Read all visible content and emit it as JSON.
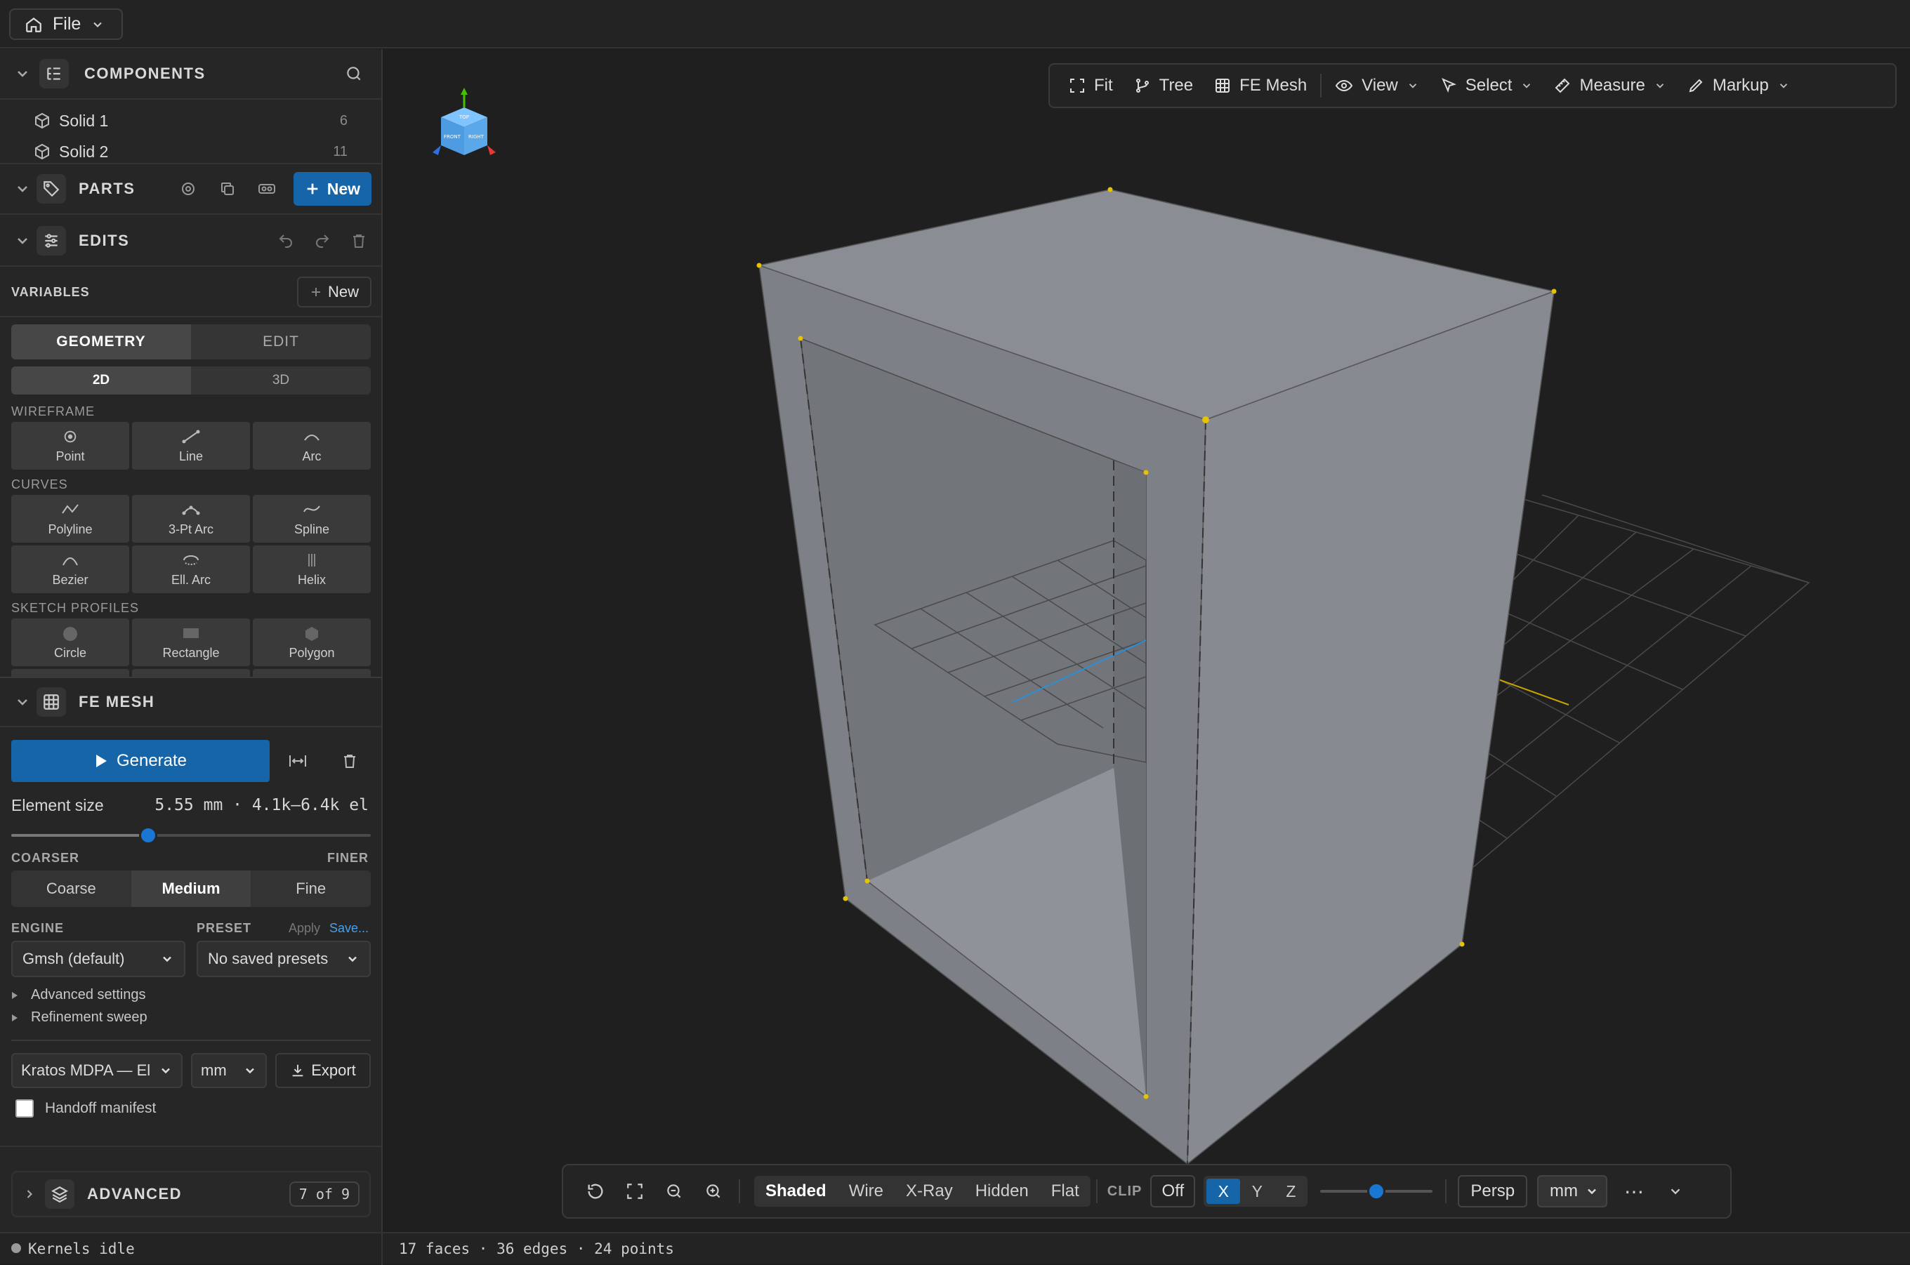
{
  "topbar": {
    "file_label": "File"
  },
  "components": {
    "title": "COMPONENTS",
    "items": [
      {
        "label": "Solid 1",
        "count": "6"
      },
      {
        "label": "Solid 2",
        "count": "11"
      }
    ]
  },
  "parts": {
    "title": "PARTS",
    "new_label": "New"
  },
  "edits": {
    "title": "EDITS"
  },
  "variables": {
    "title": "VARIABLES",
    "new_label": "New"
  },
  "geometry": {
    "tabs": [
      "GEOMETRY",
      "EDIT"
    ],
    "dims": [
      "2D",
      "3D"
    ],
    "wireframe_label": "WIREFRAME",
    "wireframe": [
      "Point",
      "Line",
      "Arc"
    ],
    "curves_label": "CURVES",
    "curves": [
      "Polyline",
      "3-Pt Arc",
      "Spline",
      "Bezier",
      "Ell. Arc",
      "Helix"
    ],
    "profiles_label": "SKETCH PROFILES",
    "profiles": [
      "Circle",
      "Rectangle",
      "Polygon"
    ]
  },
  "femesh": {
    "title": "FE MESH",
    "generate_label": "Generate",
    "element_size_label": "Element size",
    "element_size_value": "5.55 mm · 4.1k–6.4k el",
    "slider_fraction": 0.38,
    "coarser_label": "COARSER",
    "finer_label": "FINER",
    "density_options": [
      "Coarse",
      "Medium",
      "Fine"
    ],
    "density_selected": "Medium",
    "engine_label": "ENGINE",
    "engine_value": "Gmsh (default)",
    "preset_label": "PRESET",
    "preset_apply": "Apply",
    "preset_save": "Save...",
    "preset_value": "No saved presets",
    "advanced_settings": "Advanced settings",
    "refinement_sweep": "Refinement sweep",
    "export_format": "Kratos MDPA — El",
    "export_unit": "mm",
    "export_label": "Export",
    "handoff_label": "Handoff manifest"
  },
  "advanced": {
    "title": "ADVANCED",
    "badge": "7 of 9"
  },
  "viewcube": {
    "top": "TOP",
    "front": "FRONT",
    "right": "RIGHT"
  },
  "view_toolbar": {
    "fit": "Fit",
    "tree": "Tree",
    "femesh": "FE Mesh",
    "view": "View",
    "select": "Select",
    "measure": "Measure",
    "markup": "Markup"
  },
  "bottom_toolbar": {
    "modes": [
      "Shaded",
      "Wire",
      "X-Ray",
      "Hidden",
      "Flat"
    ],
    "mode_selected": "Shaded",
    "clip_label": "CLIP",
    "clip_off": "Off",
    "axes": [
      "X",
      "Y",
      "Z"
    ],
    "axis_selected": "X",
    "clip_fraction": 0.5,
    "projection": "Persp",
    "unit": "mm",
    "more": "⋯"
  },
  "status": {
    "kernel": "Kernels idle",
    "counts": "17 faces · 36 edges · 24 points"
  },
  "colors": {
    "accent": "#1565a8",
    "vertex": "#e6c200",
    "axis_x": "#e53935",
    "axis_y": "#43c200",
    "axis_z": "#2f6fe0"
  }
}
